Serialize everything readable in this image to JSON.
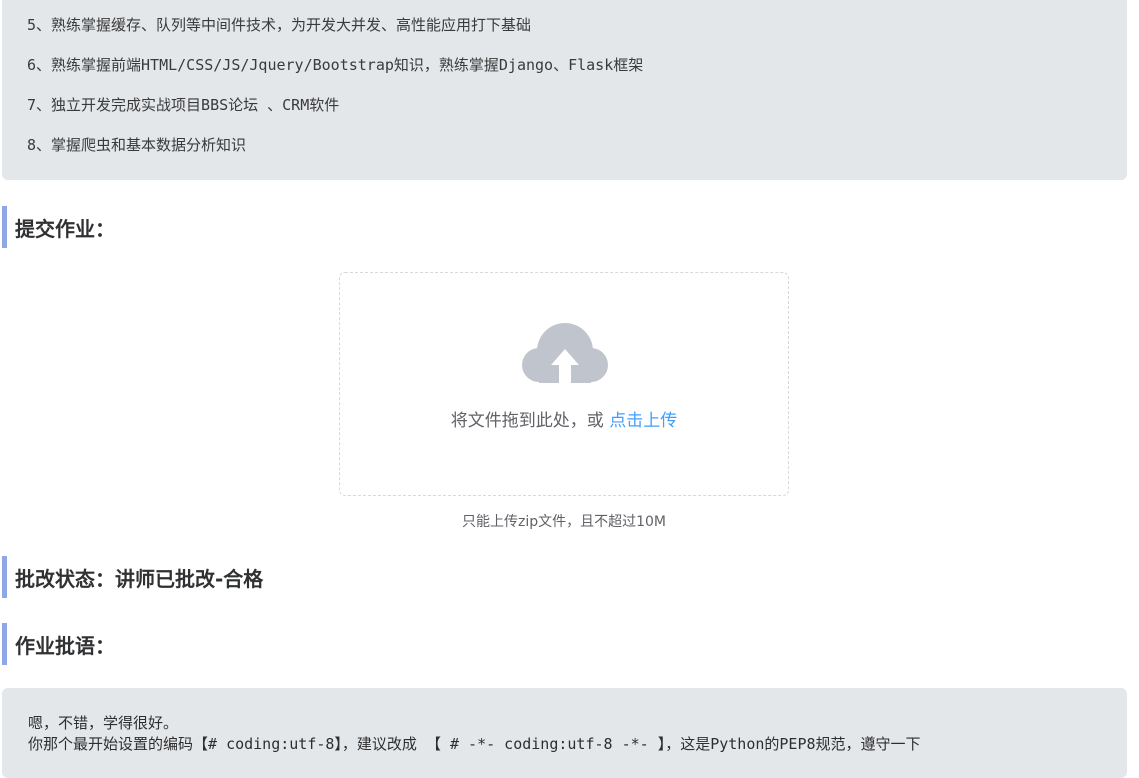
{
  "requirements": [
    "5、熟练掌握缓存、队列等中间件技术，为开发大并发、高性能应用打下基础",
    "6、熟练掌握前端HTML/CSS/JS/Jquery/Bootstrap知识，熟练掌握Django、Flask框架",
    "7、独立开发完成实战项目BBS论坛 、CRM软件",
    "8、掌握爬虫和基本数据分析知识"
  ],
  "submit": {
    "heading": "提交作业：",
    "upload_prompt": "将文件拖到此处，或 ",
    "upload_link": "点击上传",
    "upload_tip": "只能上传zip文件，且不超过10M",
    "icon": "upload-cloud-icon"
  },
  "review_status": {
    "heading": "批改状态：讲师已批改-合格"
  },
  "comment": {
    "heading": "作业批语：",
    "lines": [
      "嗯，不错，学得很好。",
      "你那个最开始设置的编码【# coding:utf-8】，建议改成 【 # -*- coding:utf-8 -*-  】，这是Python的PEP8规范，遵守一下"
    ]
  },
  "colors": {
    "accent_bar": "#8fa7e6",
    "link": "#409eff",
    "box_bg": "#e4e7ea"
  }
}
